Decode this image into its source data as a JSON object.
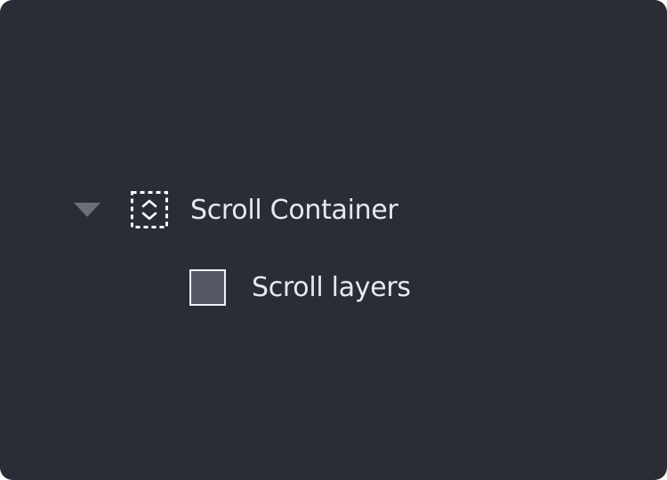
{
  "layers_panel": {
    "scroll_container": {
      "label": "Scroll Container",
      "expanded": true,
      "toggle_icon": "disclosure-triangle-down-icon",
      "type_icon": "scroll-container-icon"
    },
    "children": [
      {
        "label": "Scroll layers",
        "type_icon": "layer-swatch-icon"
      }
    ]
  },
  "colors": {
    "panel_background": "#2a2c36",
    "label_text": "#e8e9ec",
    "toggle_triangle": "#6d6f78",
    "swatch_fill": "#555862",
    "swatch_border": "#f2f2f4"
  }
}
